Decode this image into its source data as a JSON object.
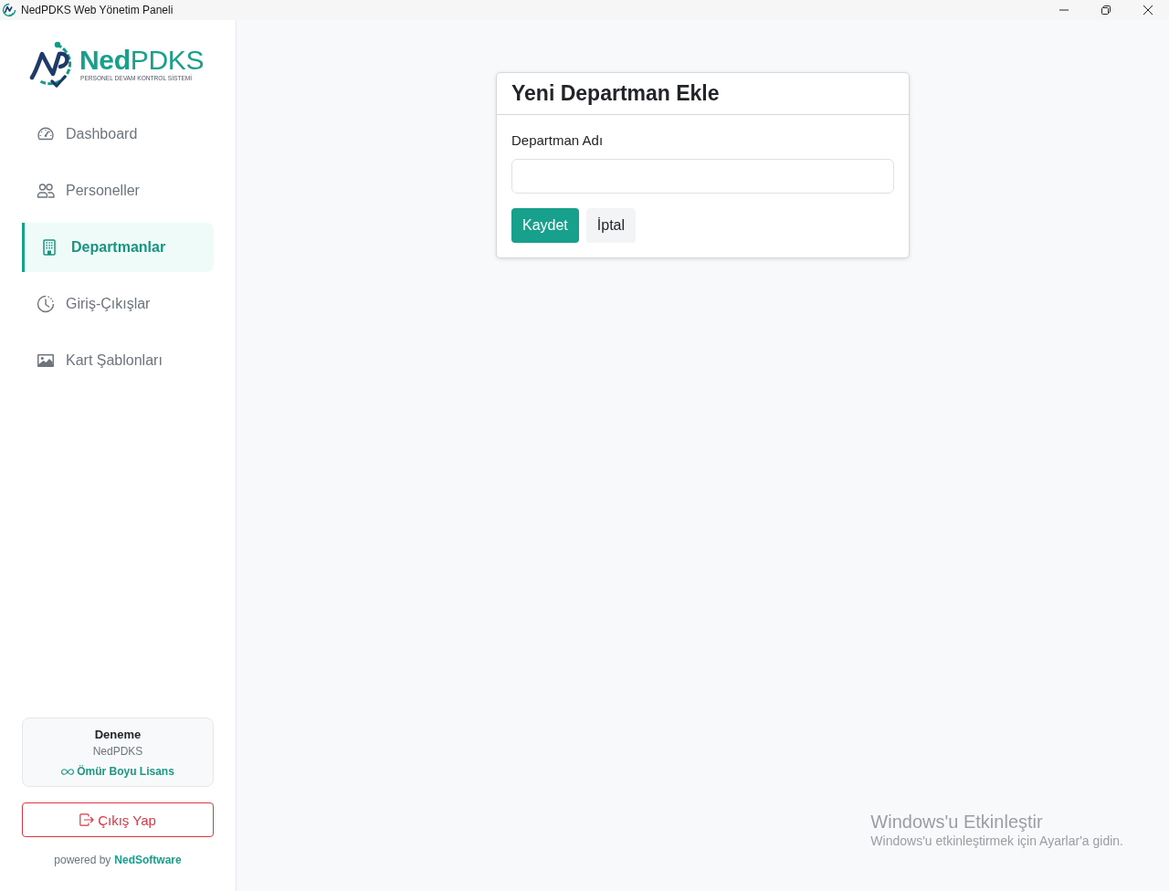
{
  "window": {
    "title": "NedPDKS Web Yönetim Paneli"
  },
  "sidebar": {
    "logo": {
      "name": "**Ned**PDKS",
      "tagline": "PERSONEL DEVAM KONTROL SİSTEMİ"
    },
    "items": [
      {
        "label": "Dashboard",
        "selected": false
      },
      {
        "label": "Personeller",
        "selected": false
      },
      {
        "label": "Departmanlar",
        "selected": true
      },
      {
        "label": "Giriş-Çıkışlar",
        "selected": false
      },
      {
        "label": "Kart Şablonları",
        "selected": false
      }
    ],
    "license": {
      "name": "Deneme",
      "product": "NedPDKS",
      "type": "Ömür Boyu Lisans"
    },
    "logout_button": "Çıkış Yap",
    "footer": {
      "prefix": "powered by",
      "brand": "NedSoftware"
    }
  },
  "form": {
    "title": "Yeni Departman Ekle",
    "field": {
      "label": "Departman Adı"
    },
    "buttons": [
      {
        "label": "Kaydet",
        "kind": "primary"
      },
      {
        "label": "İptal",
        "kind": "secondary"
      }
    ]
  },
  "activation_notice": {
    "title": "Windows'u Etkinleştir",
    "message": "Windows'u etkinleştirmek için Ayarlar'a gidin."
  }
}
